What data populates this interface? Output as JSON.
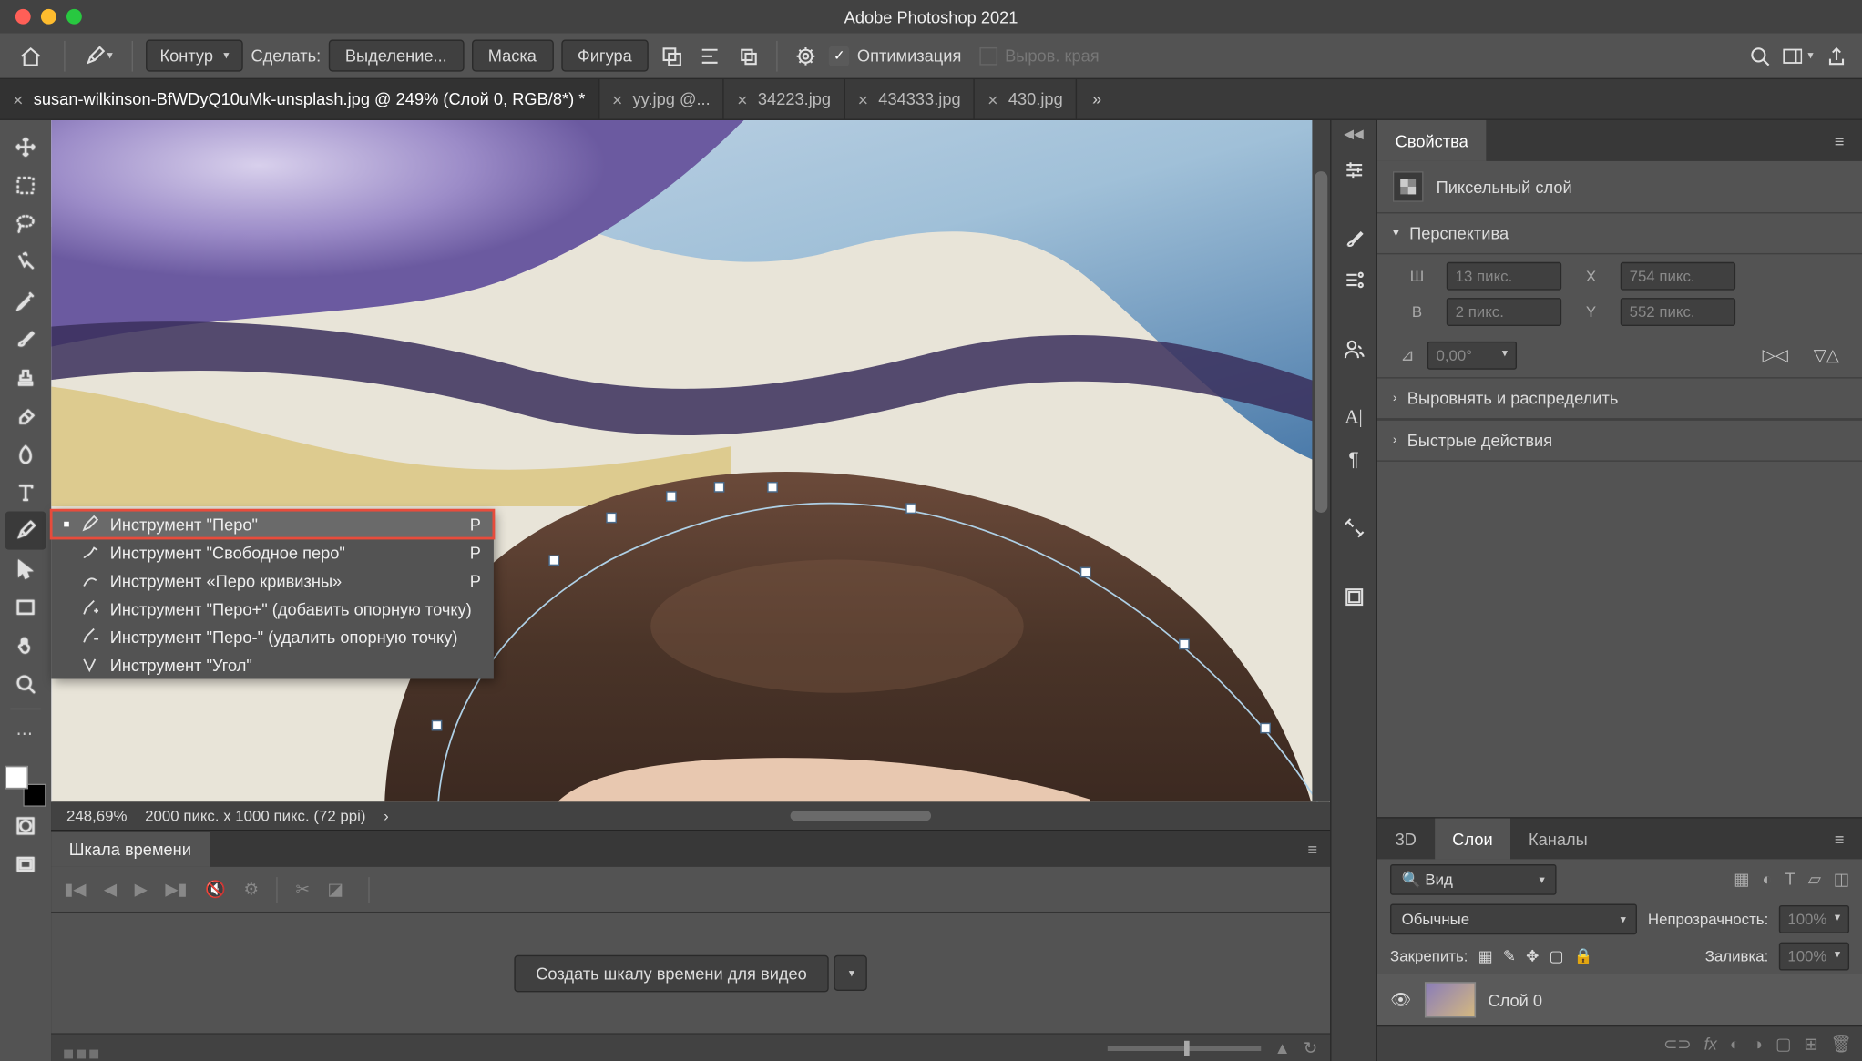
{
  "app_title": "Adobe Photoshop 2021",
  "options_bar": {
    "mode": "Контур",
    "make_label": "Сделать:",
    "selection": "Выделение...",
    "mask": "Маска",
    "shape": "Фигура",
    "optimize": "Оптимизация",
    "align_edge": "Выров. края"
  },
  "tabs": [
    {
      "name": "susan-wilkinson-BfWDyQ10uMk-unsplash.jpg @ 249% (Слой 0, RGB/8*) *",
      "active": true
    },
    {
      "name": "yy.jpg @...",
      "active": false
    },
    {
      "name": "34223.jpg",
      "active": false
    },
    {
      "name": "434333.jpg",
      "active": false
    },
    {
      "name": "430.jpg",
      "active": false
    }
  ],
  "pen_flyout": [
    {
      "label": "Инструмент \"Перо\"",
      "shortcut": "P",
      "selected": true
    },
    {
      "label": "Инструмент \"Свободное перо\"",
      "shortcut": "P",
      "selected": false
    },
    {
      "label": "Инструмент «Перо кривизны»",
      "shortcut": "P",
      "selected": false
    },
    {
      "label": "Инструмент \"Перо+\" (добавить опорную точку)",
      "shortcut": "",
      "selected": false
    },
    {
      "label": "Инструмент \"Перо-\" (удалить опорную точку)",
      "shortcut": "",
      "selected": false
    },
    {
      "label": "Инструмент \"Угол\"",
      "shortcut": "",
      "selected": false
    }
  ],
  "status": {
    "zoom": "248,69%",
    "docinfo": "2000 пикс. x 1000 пикс. (72 ppi)"
  },
  "timeline": {
    "tab": "Шкала времени",
    "create_btn": "Создать шкалу времени для видео"
  },
  "properties": {
    "tab": "Свойства",
    "layer_type": "Пиксельный слой",
    "transform": {
      "header": "Перспектива",
      "w_label": "Ш",
      "w_val": "13 пикс.",
      "h_label": "В",
      "h_val": "2 пикс.",
      "x_label": "X",
      "x_val": "754 пикс.",
      "y_label": "Y",
      "y_val": "552 пикс.",
      "angle": "0,00°"
    },
    "align_header": "Выровнять и распределить",
    "quick_header": "Быстрые действия"
  },
  "layers": {
    "tabs": [
      "3D",
      "Слои",
      "Каналы"
    ],
    "active_tab": "Слои",
    "filter": "Вид",
    "blend": "Обычные",
    "opacity_label": "Непрозрачность:",
    "opacity": "100%",
    "lock_label": "Закрепить:",
    "fill_label": "Заливка:",
    "fill": "100%",
    "layer0": "Слой 0"
  }
}
